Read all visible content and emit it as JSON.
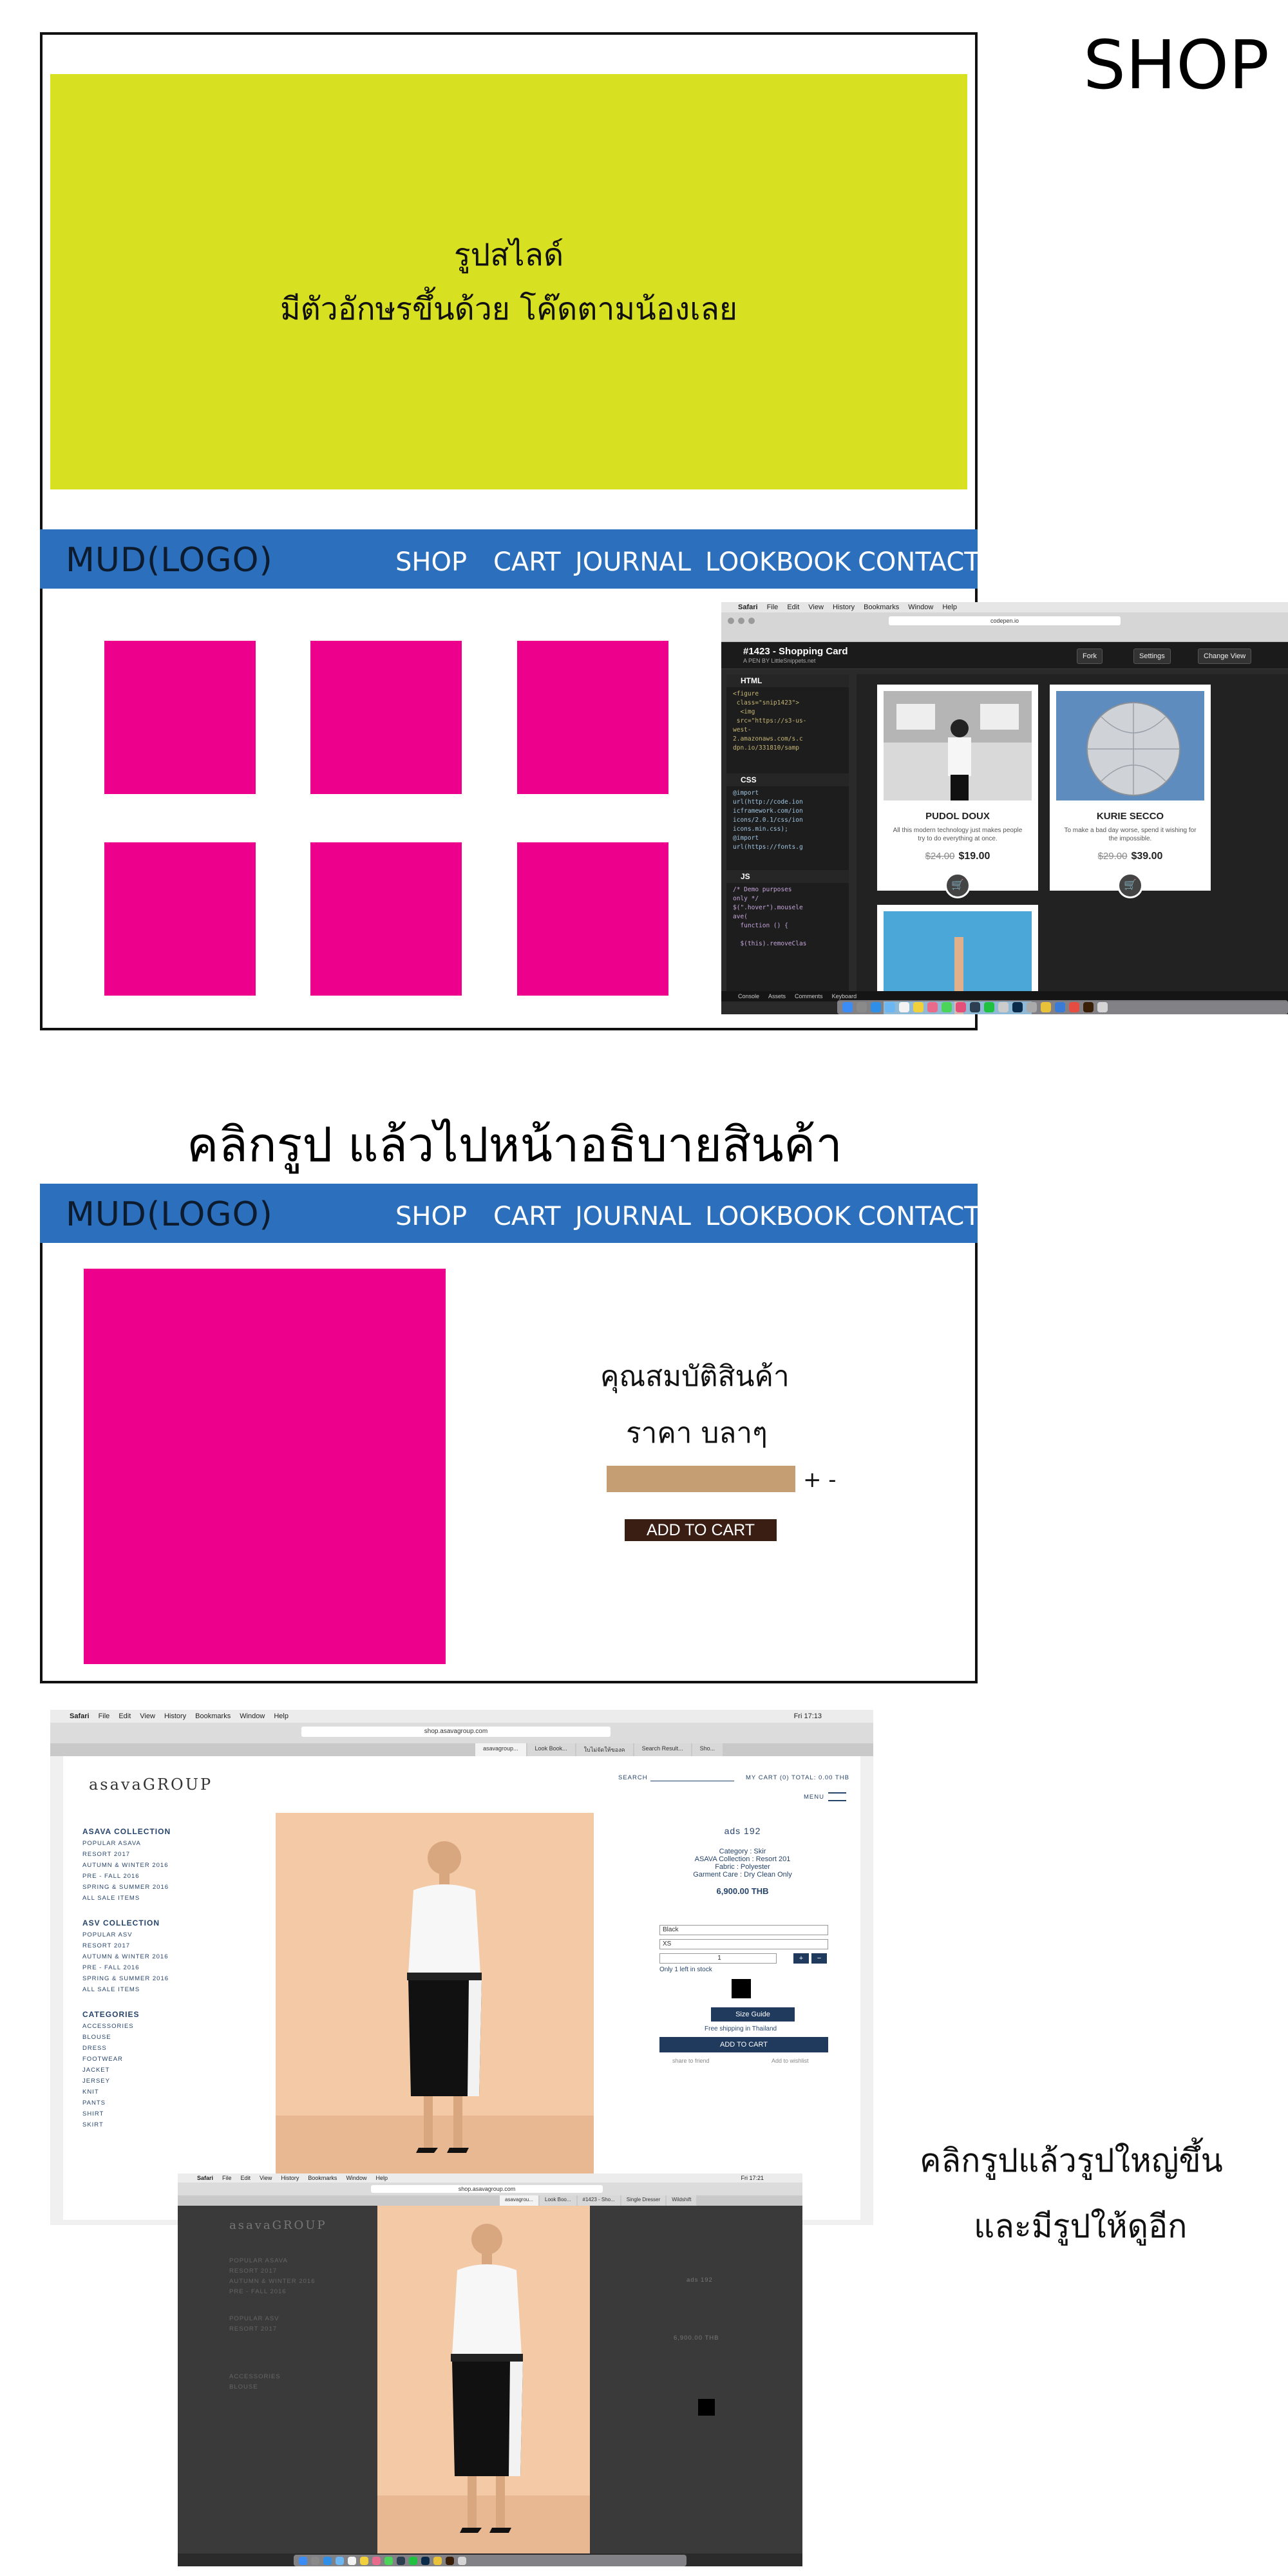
{
  "section_shop": {
    "heading": "SHOP",
    "slide_line1": "รูปสไลด์",
    "slide_line2": "มีตัวอักษรขึ้นด้วย โค๊ดตามน้องเลย",
    "colors": {
      "slide": "#d8e022",
      "nav": "#2b6fbd",
      "product": "#ec008c"
    }
  },
  "nav": {
    "logo": "MUD(LOGO)",
    "shop": "SHOP",
    "cart": "CART",
    "journal": "JOURNAL",
    "lookbook": "LOOKBOOK",
    "contact": "CONTACT"
  },
  "codepen": {
    "menu": [
      "Safari",
      "File",
      "Edit",
      "View",
      "History",
      "Bookmarks",
      "Window",
      "Help"
    ],
    "url": "codepen.io",
    "title": "#1423 - Shopping Card",
    "subtitle": "A PEN BY LittleSnippets.net",
    "fork": "Fork",
    "settings": "Settings",
    "change_view": "Change View",
    "panel_html": "HTML",
    "panel_css": "CSS",
    "panel_js": "JS",
    "code_html": "<figure\n class=\"snip1423\">\n  <img\n src=\"https://s3-us-\nwest-\n2.amazonaws.com/s.c\ndpn.io/331810/samp",
    "code_css": "@import\nurl(http://code.ion\nicframework.com/ion\nicons/2.0.1/css/ion\nicons.min.css);\n@import\nurl(https://fonts.g",
    "code_js": "/* Demo purposes\nonly */\n$(\".hover\").mousele\nave(\n  function () {\n\n  $(this).removeClas",
    "footer": [
      "Console",
      "Assets",
      "Comments",
      "Keyboard"
    ],
    "cards": [
      {
        "name": "PUDOL DOUX",
        "desc": "All this modern technology just makes people try to do everything at once.",
        "old_price": "$24.00",
        "price": "$19.00"
      },
      {
        "name": "KURIE SECCO",
        "desc": "To make a bad day worse, spend it wishing for the impossible.",
        "old_price": "$29.00",
        "price": "$39.00"
      }
    ]
  },
  "section_detail": {
    "heading": "คลิกรูป แล้วไปหน้าอธิบายสินค้า",
    "properties": "คุณสมบัติสินค้า",
    "price": "ราคา บลาๆ",
    "qty_controls": "+ -",
    "add_to_cart": "ADD TO CART",
    "colors": {
      "qty_bar": "#c69e73",
      "button": "#3a1e14"
    }
  },
  "asava": {
    "menu": [
      "Safari",
      "File",
      "Edit",
      "View",
      "History",
      "Bookmarks",
      "Window",
      "Help"
    ],
    "status": "Fri 17:13",
    "url": "shop.asavagroup.com",
    "tabs": [
      "asavagroup...",
      "Look Book...",
      "ใบไม่จัดให้ของค",
      "Search Result...",
      "Sho..."
    ],
    "brand": "asavaGROUP",
    "search": "SEARCH",
    "cart_total": "MY CART (0)   TOTAL: 0.00 THB",
    "menu_label": "MENU",
    "col1_title": "ASAVA COLLECTION",
    "col1_items": [
      "POPULAR ASAVA",
      "RESORT 2017",
      "AUTUMN & WINTER 2016",
      "PRE - FALL 2016",
      "SPRING & SUMMER 2016",
      "ALL SALE ITEMS"
    ],
    "col2_title": "ASV COLLECTION",
    "col2_items": [
      "POPULAR ASV",
      "RESORT 2017",
      "AUTUMN & WINTER 2016",
      "PRE - FALL 2016",
      "SPRING & SUMMER 2016",
      "ALL SALE ITEMS"
    ],
    "col3_title": "CATEGORIES",
    "col3_items": [
      "ACCESSORIES",
      "BLOUSE",
      "DRESS",
      "FOOTWEAR",
      "JACKET",
      "JERSEY",
      "KNIT",
      "PANTS",
      "SHIRT",
      "SKIRT"
    ],
    "product_name": "ads 192",
    "category": "Category : Skir",
    "collection": "ASAVA Collection : Resort 201",
    "fabric": "Fabric : Polyester",
    "care": "Garment Care : Dry Clean Only",
    "price": "6,900.00 THB",
    "color_select": "Black",
    "size_select": "XS",
    "qty_value": "1",
    "stock": "Only 1 left in stock",
    "size_guide": "Size Guide",
    "shipping": "Free shipping in Thailand",
    "add_to_cart": "ADD TO CART",
    "share": "share to friend",
    "wishlist": "Add to wishlist",
    "second_status": "Fri 17:21",
    "second_tabs": [
      "asavagrou...",
      "Look Boo...",
      "#1423 - Sho...",
      "Single Dresser",
      "Wildshift"
    ]
  },
  "side_note_line1": "คลิกรูปแล้วรูปใหญ่ขึ้น",
  "side_note_line2": "และมีรูปให้ดูอีก"
}
